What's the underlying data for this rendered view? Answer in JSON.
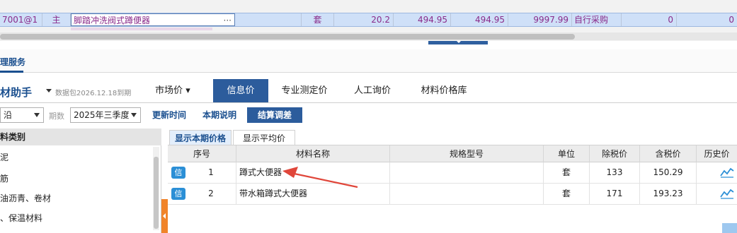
{
  "top_row": {
    "code": "7001@1",
    "type": "主",
    "name": "脚踏冲洗阀式蹲便器",
    "ellipsis": "···",
    "unit": "套",
    "qty": "20.2",
    "price1": "494.95",
    "price2": "494.95",
    "amount": "9997.99",
    "source": "自行采购",
    "v1": "0",
    "v2": "0"
  },
  "service_tab": "理服务",
  "helper": {
    "title": "材助手",
    "package": "数据包2026.12.18到期",
    "tabs": [
      "市场价 ▾",
      "信息价",
      "专业测定价",
      "人工询价",
      "材料价格库"
    ],
    "active_tab": "信息价"
  },
  "toolbar": {
    "region_value": "沿",
    "period_label": "期数",
    "period_value": "2025年三季度",
    "btn_update": "更新时间",
    "btn_desc": "本期说明",
    "btn_settle": "结算调差"
  },
  "category": {
    "header": "料类别",
    "items": [
      "泥",
      "筋",
      "油沥青、卷材",
      "、保温材料"
    ]
  },
  "subtabs": [
    "显示本期价格",
    "显示平均价"
  ],
  "table": {
    "headers": [
      "序号",
      "材料名称",
      "规格型号",
      "单位",
      "除税价",
      "含税价",
      "历史价"
    ],
    "rows": [
      {
        "badge": "信",
        "no": "1",
        "name": "蹲式大便器",
        "spec": "",
        "unit": "套",
        "ex_tax": "133",
        "in_tax": "150.29"
      },
      {
        "badge": "信",
        "no": "2",
        "name": "带水箱蹲式大便器",
        "spec": "",
        "unit": "套",
        "ex_tax": "171",
        "in_tax": "193.23"
      }
    ]
  },
  "colors": {
    "accent": "#2c5c9c",
    "badge": "#2b8fd6",
    "arrow": "#e0463a",
    "splitter": "#f0842a"
  }
}
